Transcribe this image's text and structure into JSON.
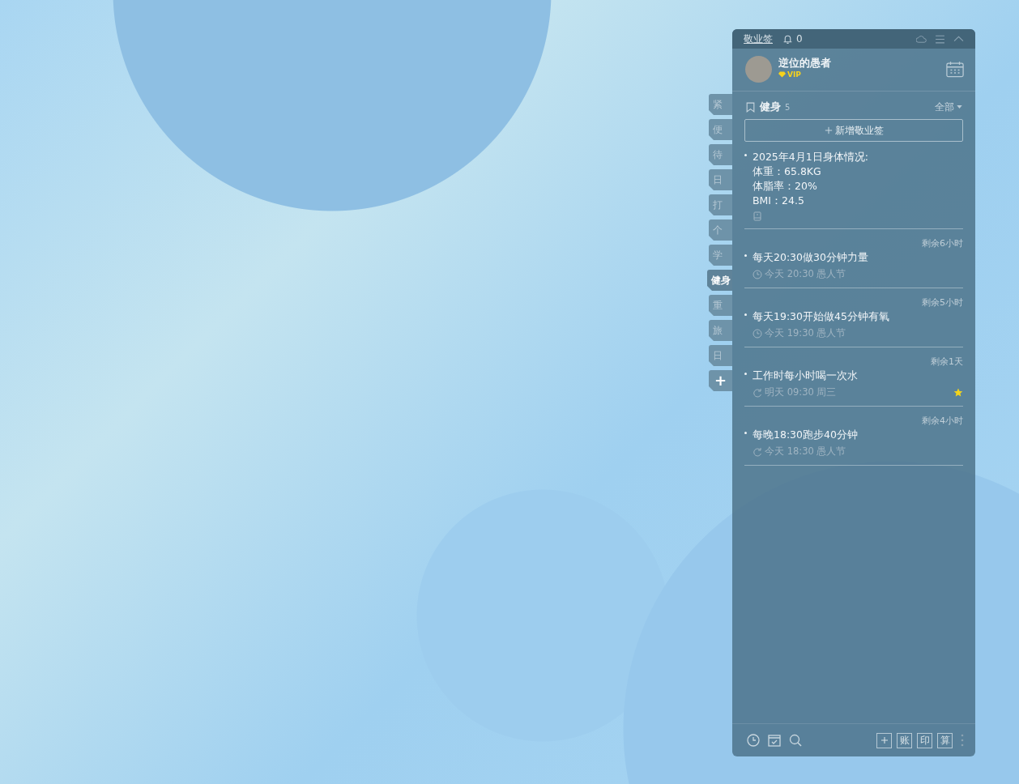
{
  "app": {
    "title": "敬业签",
    "notifications": "0"
  },
  "user": {
    "name": "逆位的愚者",
    "badge": "VIP"
  },
  "side_tabs": [
    {
      "label": "紧",
      "selected": false
    },
    {
      "label": "便",
      "selected": false
    },
    {
      "label": "待",
      "selected": false
    },
    {
      "label": "日",
      "selected": false
    },
    {
      "label": "打",
      "selected": false
    },
    {
      "label": "个",
      "selected": false
    },
    {
      "label": "学",
      "selected": false
    },
    {
      "label": "健身",
      "selected": true
    },
    {
      "label": "重",
      "selected": false
    },
    {
      "label": "旅",
      "selected": false
    },
    {
      "label": "日",
      "selected": false
    }
  ],
  "add_tab": "+",
  "category": {
    "name": "健身",
    "count": "5",
    "filter": "全部"
  },
  "new_button": {
    "label": "新增敬业签"
  },
  "items": [
    {
      "kind": "note",
      "lines": [
        "2025年4月1日身体情况:",
        "体重：65.8KG",
        "体脂率：20%",
        "BMI：24.5"
      ]
    },
    {
      "kind": "reminder",
      "remaining": "剩余6小时",
      "title": "每天20:30做30分钟力量",
      "time": "今天 20:30 愚人节",
      "repeat": false,
      "starred": false
    },
    {
      "kind": "reminder",
      "remaining": "剩余5小时",
      "title": "每天19:30开始做45分钟有氧",
      "time": "今天 19:30 愚人节",
      "repeat": false,
      "starred": false
    },
    {
      "kind": "reminder",
      "remaining": "剩余1天",
      "title": "工作时每小时喝一次水",
      "time": "明天 09:30 周三",
      "repeat": true,
      "starred": true
    },
    {
      "kind": "reminder",
      "remaining": "剩余4小时",
      "title": "每晚18:30跑步40分钟",
      "time": "今天 18:30 愚人节",
      "repeat": true,
      "starred": false
    }
  ],
  "bottom_tools": [
    "账",
    "印",
    "算"
  ]
}
